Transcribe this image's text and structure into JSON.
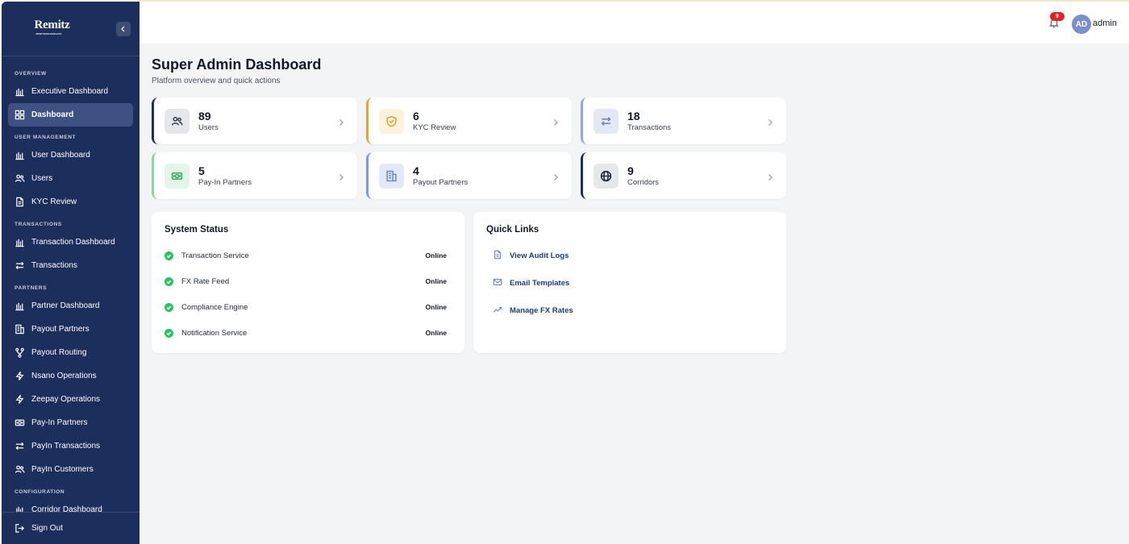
{
  "brand": {
    "name": "Remitz",
    "tagline": "REMITTANCE MADE EASY"
  },
  "sidebar": {
    "sections": [
      {
        "label": "OVERVIEW",
        "items": [
          {
            "label": "Executive Dashboard",
            "icon": "bar-chart-icon",
            "active": false
          },
          {
            "label": "Dashboard",
            "icon": "grid-icon",
            "active": true
          }
        ]
      },
      {
        "label": "USER MANAGEMENT",
        "items": [
          {
            "label": "User Dashboard",
            "icon": "bar-chart-icon",
            "active": false
          },
          {
            "label": "Users",
            "icon": "users-icon",
            "active": false
          },
          {
            "label": "KYC Review",
            "icon": "document-icon",
            "active": false
          }
        ]
      },
      {
        "label": "TRANSACTIONS",
        "items": [
          {
            "label": "Transaction Dashboard",
            "icon": "bar-chart-icon",
            "active": false
          },
          {
            "label": "Transactions",
            "icon": "swap-icon",
            "active": false
          }
        ]
      },
      {
        "label": "PARTNERS",
        "items": [
          {
            "label": "Partner Dashboard",
            "icon": "bar-chart-icon",
            "active": false
          },
          {
            "label": "Payout Partners",
            "icon": "building-icon",
            "active": false
          },
          {
            "label": "Payout Routing",
            "icon": "routing-icon",
            "active": false
          },
          {
            "label": "Nsano Operations",
            "icon": "bolt-icon",
            "active": false
          },
          {
            "label": "Zeepay Operations",
            "icon": "bolt-icon",
            "active": false
          },
          {
            "label": "Pay-In Partners",
            "icon": "cash-icon",
            "active": false
          },
          {
            "label": "PayIn Transactions",
            "icon": "swap-icon",
            "active": false
          },
          {
            "label": "PayIn Customers",
            "icon": "users-icon",
            "active": false
          }
        ]
      },
      {
        "label": "CONFIGURATION",
        "items": [
          {
            "label": "Corridor Dashboard",
            "icon": "bar-chart-icon",
            "active": false
          }
        ]
      }
    ],
    "sign_out": "Sign Out"
  },
  "topbar": {
    "notification_count": "9",
    "avatar_initials": "AD",
    "username": "admin"
  },
  "page": {
    "title": "Super Admin Dashboard",
    "subtitle": "Platform overview and quick actions"
  },
  "stats": [
    {
      "value": "89",
      "label": "Users",
      "icon": "users-icon",
      "accent": "#1c2e5b",
      "icon_bg": "#e5e7eb",
      "icon_color": "#374151"
    },
    {
      "value": "6",
      "label": "KYC Review",
      "icon": "shield-check-icon",
      "accent": "#e0a63a",
      "icon_bg": "#fdf3dc",
      "icon_color": "#d9a12b"
    },
    {
      "value": "18",
      "label": "Transactions",
      "icon": "swap-icon",
      "accent": "#93a4d8",
      "icon_bg": "#e3e8f6",
      "icon_color": "#6b7fbf"
    },
    {
      "value": "5",
      "label": "Pay-In Partners",
      "icon": "cash-icon",
      "accent": "#8fd3a0",
      "icon_bg": "#e3f5e8",
      "icon_color": "#3aa55a"
    },
    {
      "value": "4",
      "label": "Payout Partners",
      "icon": "building-icon",
      "accent": "#7f98d6",
      "icon_bg": "#e3e9f8",
      "icon_color": "#6a86cf"
    },
    {
      "value": "9",
      "label": "Corridors",
      "icon": "globe-icon",
      "accent": "#1c2e5b",
      "icon_bg": "#e5e7eb",
      "icon_color": "#1f2937"
    }
  ],
  "system_status": {
    "title": "System Status",
    "services": [
      {
        "name": "Transaction Service",
        "status": "Online"
      },
      {
        "name": "FX Rate Feed",
        "status": "Online"
      },
      {
        "name": "Compliance Engine",
        "status": "Online"
      },
      {
        "name": "Notification Service",
        "status": "Online"
      }
    ]
  },
  "quick_links": {
    "title": "Quick Links",
    "links": [
      {
        "label": "View Audit Logs",
        "icon": "document-icon"
      },
      {
        "label": "Email Templates",
        "icon": "mail-icon"
      },
      {
        "label": "Manage FX Rates",
        "icon": "trend-up-icon"
      }
    ]
  }
}
